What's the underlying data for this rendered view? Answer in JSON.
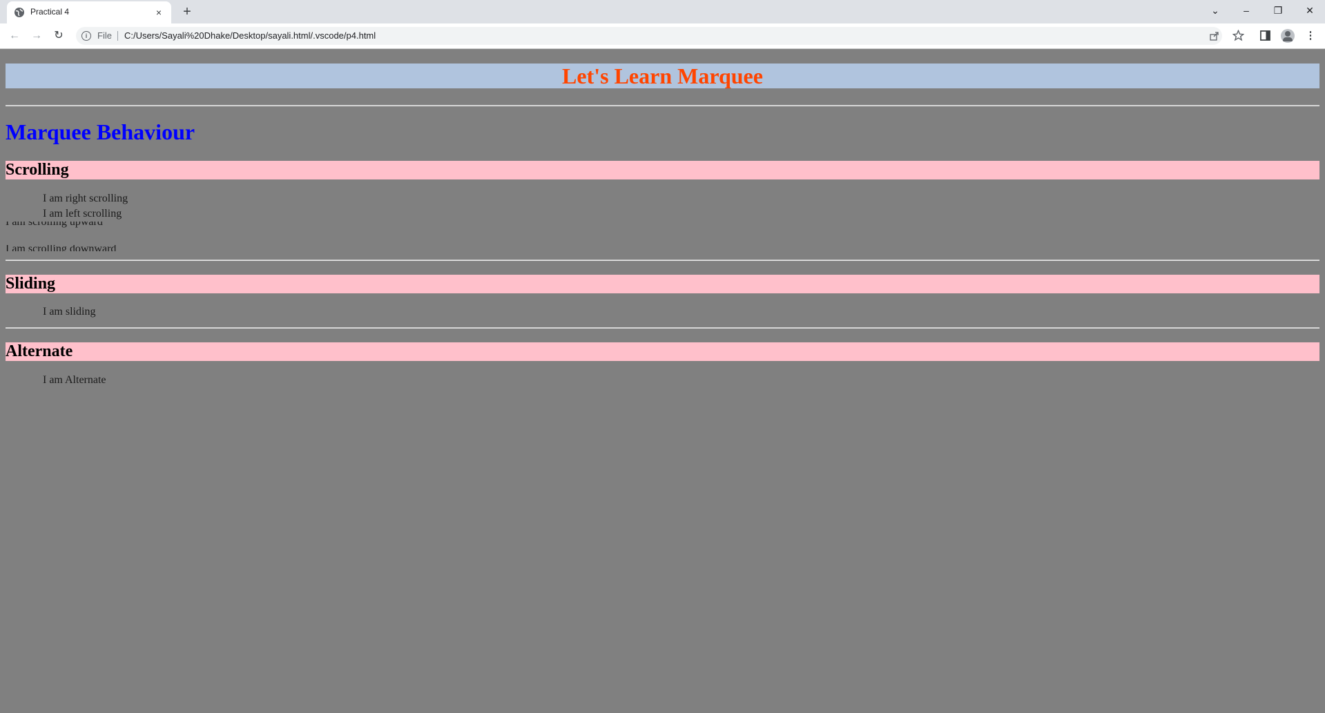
{
  "browser": {
    "tab_title": "Practical 4",
    "tab_close": "×",
    "new_tab": "+",
    "url_scheme": "File",
    "url": "C:/Users/Sayali%20Dhake/Desktop/sayali.html/.vscode/p4.html",
    "window_controls": {
      "dropdown": "⌄",
      "minimize": "–",
      "restore": "❐",
      "close": "✕"
    },
    "nav": {
      "back": "←",
      "forward": "→",
      "reload": "↻"
    },
    "icons": {
      "share": "share-icon",
      "star": "star-icon",
      "sidepanel": "side-panel-icon",
      "menu": "⋮"
    }
  },
  "page": {
    "colors": {
      "background": "#808080",
      "title_bg": "#b0c4de",
      "title_fg": "#ff4500",
      "heading_fg": "#0000ff",
      "band_bg": "#ffc0cb"
    },
    "main_title": "Let's Learn Marquee",
    "section_title": "Marquee Behaviour",
    "scrolling": {
      "heading": "Scrolling",
      "right": "I am right scrolling",
      "left": "I am left scrolling",
      "up": "I am scrolling upward",
      "down": "I am scrolling downward"
    },
    "sliding": {
      "heading": "Sliding",
      "text": "I am sliding"
    },
    "alternate": {
      "heading": "Alternate",
      "text": "I am Alternate"
    }
  }
}
